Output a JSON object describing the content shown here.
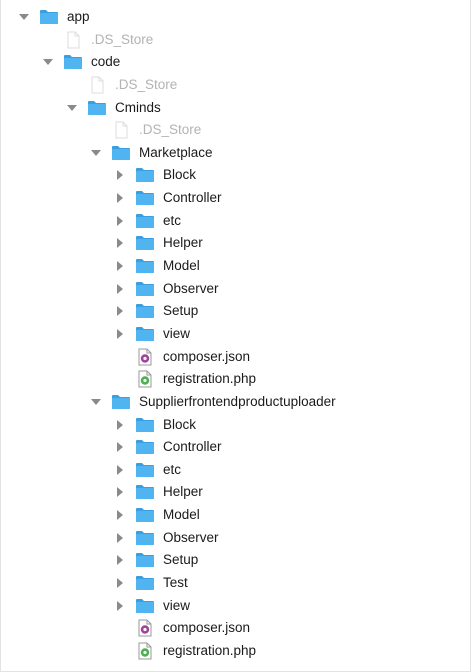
{
  "tree": [
    {
      "label": "app",
      "type": "folder",
      "depth": 0,
      "expanded": true
    },
    {
      "label": ".DS_Store",
      "type": "hidden-file",
      "depth": 1
    },
    {
      "label": "code",
      "type": "folder",
      "depth": 1,
      "expanded": true
    },
    {
      "label": ".DS_Store",
      "type": "hidden-file",
      "depth": 2
    },
    {
      "label": "Cminds",
      "type": "folder",
      "depth": 2,
      "expanded": true
    },
    {
      "label": ".DS_Store",
      "type": "hidden-file",
      "depth": 3
    },
    {
      "label": "Marketplace",
      "type": "folder",
      "depth": 3,
      "expanded": true
    },
    {
      "label": "Block",
      "type": "folder",
      "depth": 4,
      "expanded": false
    },
    {
      "label": "Controller",
      "type": "folder",
      "depth": 4,
      "expanded": false
    },
    {
      "label": "etc",
      "type": "folder",
      "depth": 4,
      "expanded": false
    },
    {
      "label": "Helper",
      "type": "folder",
      "depth": 4,
      "expanded": false
    },
    {
      "label": "Model",
      "type": "folder",
      "depth": 4,
      "expanded": false
    },
    {
      "label": "Observer",
      "type": "folder",
      "depth": 4,
      "expanded": false
    },
    {
      "label": "Setup",
      "type": "folder",
      "depth": 4,
      "expanded": false
    },
    {
      "label": "view",
      "type": "folder",
      "depth": 4,
      "expanded": false
    },
    {
      "label": "composer.json",
      "type": "json",
      "depth": 4
    },
    {
      "label": "registration.php",
      "type": "php",
      "depth": 4
    },
    {
      "label": "Supplierfrontendproductuploader",
      "type": "folder",
      "depth": 3,
      "expanded": true
    },
    {
      "label": "Block",
      "type": "folder",
      "depth": 4,
      "expanded": false
    },
    {
      "label": "Controller",
      "type": "folder",
      "depth": 4,
      "expanded": false
    },
    {
      "label": "etc",
      "type": "folder",
      "depth": 4,
      "expanded": false
    },
    {
      "label": "Helper",
      "type": "folder",
      "depth": 4,
      "expanded": false
    },
    {
      "label": "Model",
      "type": "folder",
      "depth": 4,
      "expanded": false
    },
    {
      "label": "Observer",
      "type": "folder",
      "depth": 4,
      "expanded": false
    },
    {
      "label": "Setup",
      "type": "folder",
      "depth": 4,
      "expanded": false
    },
    {
      "label": "Test",
      "type": "folder",
      "depth": 4,
      "expanded": false
    },
    {
      "label": "view",
      "type": "folder",
      "depth": 4,
      "expanded": false
    },
    {
      "label": "composer.json",
      "type": "json",
      "depth": 4
    },
    {
      "label": "registration.php",
      "type": "php",
      "depth": 4
    }
  ],
  "colors": {
    "folder": "#4fb4f0",
    "folder_tab": "#3a9fe0",
    "text": "#1a1a1a",
    "hidden_text": "#b3b3b3",
    "json_badge": "#a0439a",
    "php_badge": "#4caf50"
  }
}
